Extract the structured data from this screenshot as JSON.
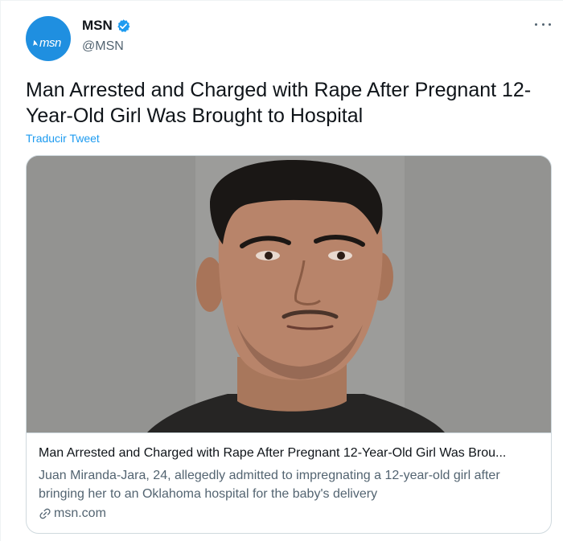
{
  "account": {
    "display_name": "MSN",
    "handle": "@MSN",
    "avatar_text": "msn",
    "verified": true
  },
  "icons": {
    "avatar": "msn-logo-icon",
    "verified": "verified-badge-icon",
    "more": "more-options-icon",
    "link": "link-icon"
  },
  "tweet": {
    "text": "Man Arrested and Charged with Rape After Pregnant 12-Year-Old Girl Was Brought to Hospital",
    "translate_label": "Traducir Tweet"
  },
  "card": {
    "title": "Man Arrested and Charged with Rape After Pregnant 12-Year-Old Girl Was Brou...",
    "description": "Juan Miranda-Jara, 24, allegedly admitted to impregnating a 12-year-old girl after bringing her to an Oklahoma hospital for the baby's delivery",
    "domain": "msn.com"
  },
  "colors": {
    "accent": "#1d9bf0",
    "avatar_bg": "#1f8fe0",
    "text_primary": "#0f1419",
    "text_secondary": "#536471",
    "border": "#cfd9de"
  }
}
